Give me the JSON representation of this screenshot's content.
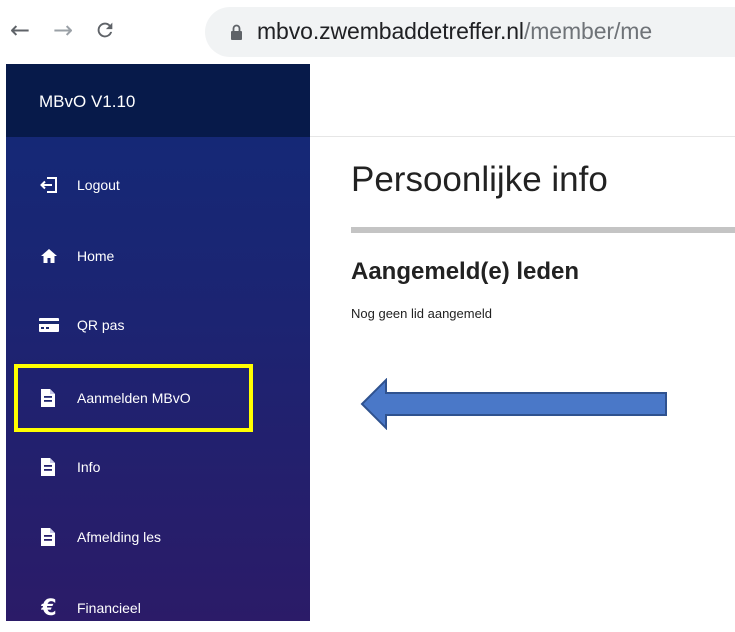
{
  "browser": {
    "url_host": "mbvo.zwembaddetreffer.nl",
    "url_path": "/member/me",
    "icons": {
      "back": "back-arrow-icon",
      "forward": "forward-arrow-icon",
      "reload": "reload-icon",
      "lock": "lock-icon"
    }
  },
  "sidebar": {
    "app_title": "MBvO V1.10",
    "items": [
      {
        "label": "Logout",
        "icon": "logout-icon"
      },
      {
        "label": "Home",
        "icon": "home-icon"
      },
      {
        "label": "QR pas",
        "icon": "card-icon"
      },
      {
        "label": "Aanmelden MBvO",
        "icon": "document-icon",
        "highlighted": true
      },
      {
        "label": "Info",
        "icon": "document-icon"
      },
      {
        "label": "Afmelding les",
        "icon": "document-icon"
      },
      {
        "label": "Financieel",
        "icon": "euro-icon"
      }
    ]
  },
  "main": {
    "page_title": "Persoonlijke info",
    "section_title": "Aangemeld(e) leden",
    "empty_message": "Nog geen lid aangemeld"
  },
  "annotations": {
    "highlight_color": "#ffff00",
    "arrow_color": "#4a78c8",
    "arrow_outline": "#2f528f"
  }
}
